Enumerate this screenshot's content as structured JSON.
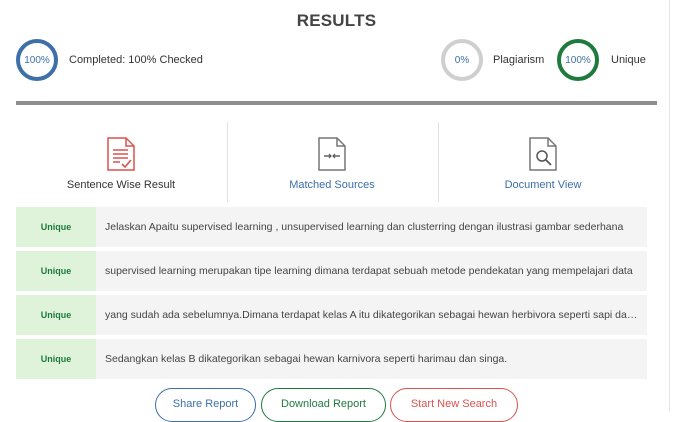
{
  "header": {
    "title": "RESULTS"
  },
  "summary": {
    "completed": {
      "value": "100%",
      "label": "Completed: 100% Checked",
      "color": "#3d6fa8"
    },
    "plagiarism": {
      "value": "0%",
      "label": "Plagiarism",
      "color": "#cfcfcf"
    },
    "unique": {
      "value": "100%",
      "label": "Unique",
      "color": "#1f7a3e"
    }
  },
  "tabs": [
    {
      "label": "Sentence Wise Result",
      "icon": "document-check-icon",
      "color": "#d9534f"
    },
    {
      "label": "Matched Sources",
      "icon": "document-compare-icon"
    },
    {
      "label": "Document View",
      "icon": "document-search-icon"
    }
  ],
  "results": [
    {
      "status": "Unique",
      "text": "Jelaskan Apaitu supervised learning , unsupervised learning dan clusterring dengan ilustrasi gambar sederhana"
    },
    {
      "status": "Unique",
      "text": "supervised learning merupakan tipe learning dimana terdapat sebuah metode pendekatan yang mempelajari data"
    },
    {
      "status": "Unique",
      "text": "yang sudah ada sebelumnya.Dimana terdapat kelas A itu dikategorikan sebagai hewan herbivora seperti sapi dan kuda"
    },
    {
      "status": "Unique",
      "text": "Sedangkan kelas B dikategorikan sebagai hewan karnivora seperti harimau dan singa."
    }
  ],
  "actions": {
    "share": "Share Report",
    "download": "Download Report",
    "new_search": "Start New Search"
  }
}
